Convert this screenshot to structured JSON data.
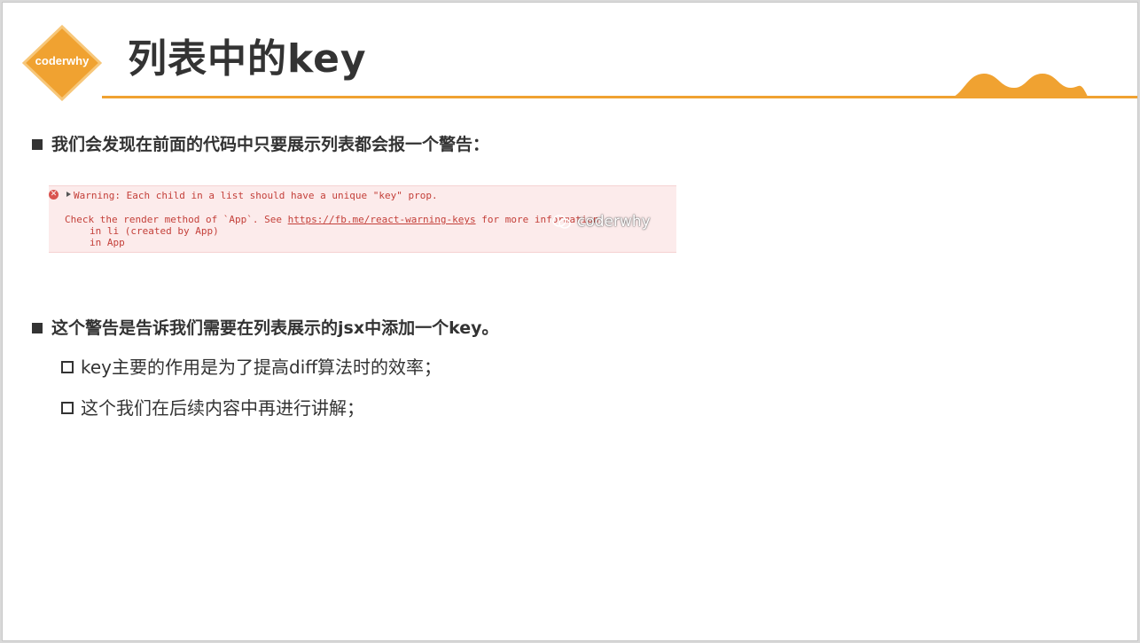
{
  "logo": {
    "text": "coderwhy",
    "color": "#f0a231"
  },
  "title": "列表中的key",
  "accent_color": "#f0a231",
  "bullets": [
    {
      "text": "我们会发现在前面的代码中只要展示列表都会报一个警告："
    },
    {
      "text": "这个警告是告诉我们需要在列表展示的jsx中添加一个key。"
    }
  ],
  "sub_bullets": [
    {
      "text": "key主要的作用是为了提高diff算法时的效率；"
    },
    {
      "text": "这个我们在后续内容中再进行讲解；"
    }
  ],
  "console": {
    "error_icon": "error-circle-icon",
    "expand_icon": "expand-triangle-icon",
    "warning": "Warning: Each child in a list should have a unique \"key\" prop.",
    "check_prefix": "Check the render method of `App`. See ",
    "link": "https://fb.me/react-warning-keys",
    "check_suffix": " for more information.",
    "stack_1": "in li (created by App)",
    "stack_2": "in App",
    "watermark": "coderwhy"
  }
}
